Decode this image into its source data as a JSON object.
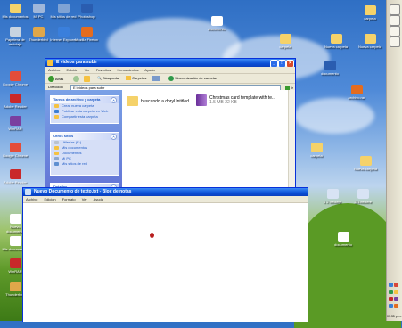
{
  "desktop": {
    "icons": [
      {
        "label": "Mis documentos",
        "color": "#f2d36b"
      },
      {
        "label": "Mi PC",
        "color": "#9fb7da"
      },
      {
        "label": "Mis sitios de red",
        "color": "#7fa3d4"
      },
      {
        "label": "Papelera de reciclaje",
        "color": "#c7d3e0"
      },
      {
        "label": "Internet Explorer",
        "color": "#3a7fdc"
      },
      {
        "label": "Thunderbird",
        "color": "#e0a74a"
      },
      {
        "label": "Google Chrome",
        "color": "#e44d3a"
      },
      {
        "label": "Mozilla Firefox",
        "color": "#e46c1f"
      },
      {
        "label": "Adobe Reader",
        "color": "#c9282a"
      },
      {
        "label": "Photoshop",
        "color": "#2a5db0"
      },
      {
        "label": "WinRAR",
        "color": "#7a3fa0"
      },
      {
        "label": "Nuevo documento",
        "color": "#ffffff"
      }
    ],
    "right_icons": [
      {
        "label": "carpeta",
        "color": "#f5d26a"
      },
      {
        "label": "Nueva carpeta",
        "color": "#f5d26a"
      },
      {
        "label": "documento",
        "color": "#ffffff"
      },
      {
        "label": "archivo.rar",
        "color": "#8a4fb8"
      },
      {
        "label": "1 2 treciere",
        "color": "#d8e3f4"
      },
      {
        "label": "121treciere",
        "color": "#d8e3f4"
      }
    ]
  },
  "explorer": {
    "title": "E videos para subir",
    "menu": [
      "Archivo",
      "Edición",
      "Ver",
      "Favoritos",
      "Herramientas",
      "Ayuda"
    ],
    "toolbar": {
      "back": "Atrás",
      "search": "Búsqueda",
      "folders": "Carpetas",
      "sync": "Sincronización de carpetas"
    },
    "address_label": "Dirección",
    "address_value": "E:\\videos para subir",
    "go": "Ir",
    "tasks_header": "Tareas de archivo y carpeta",
    "tasks": [
      "Crear nueva carpeta",
      "Publicar esta carpeta en Web",
      "Compartir esta carpeta"
    ],
    "places_header": "Otros sitios",
    "places": [
      "Utilerías (E:)",
      "Mis documentos",
      "Documentos",
      "Mi PC",
      "Mis sitios de red"
    ],
    "details_header": "Detalles",
    "files": [
      {
        "name": "buscando a doryUntitled",
        "meta": ""
      },
      {
        "name": "Christmas card template with te...",
        "meta": "1.5 MB 22 KB"
      }
    ]
  },
  "notepad": {
    "title": "Nuevo Documento de texto.txt - Bloc de notas",
    "menu": [
      "Archivo",
      "Edición",
      "Formato",
      "Ver",
      "Ayuda"
    ]
  },
  "taskbar": {
    "clock": "07:35 p.m."
  }
}
